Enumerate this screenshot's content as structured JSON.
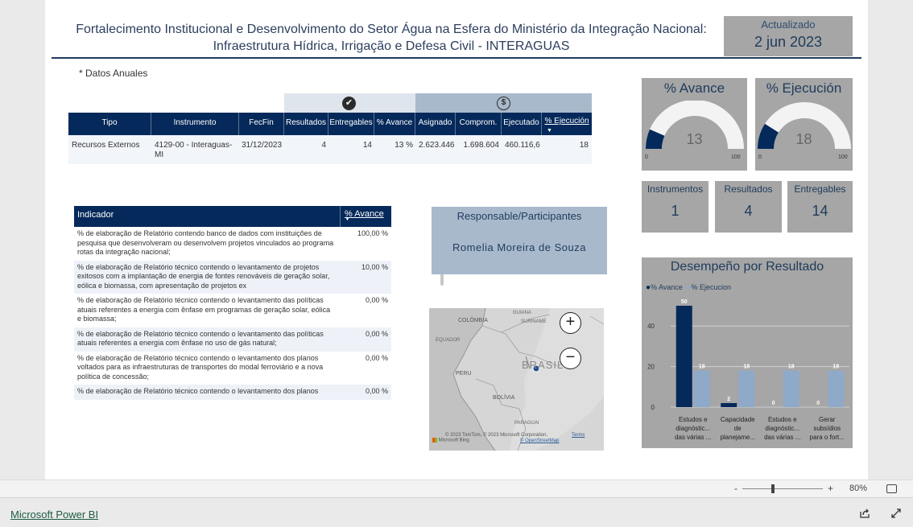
{
  "header": {
    "title_line1": "Fortalecimento Institucional e Desenvolvimento do Setor Água na Esfera do Ministério da Integração Nacional:",
    "title_line2": "Infraestrutura Hídrica, Irrigação e Defesa Civil - INTERAGUAS",
    "updated_label": "Actualizado",
    "updated_value": "2 jun 2023"
  },
  "note": "* Datos Anuales",
  "summary_table": {
    "group_icons": [
      "check-circle-icon",
      "dollar-circle-icon"
    ],
    "columns": [
      "Tipo",
      "Instrumento",
      "FecFin",
      "Resultados",
      "Entregables",
      "% Avance",
      "Asignado",
      "Comprom.",
      "Ejecutado",
      "% Ejecución"
    ],
    "row": [
      "Recursos Externos",
      "4129-00 - Interaguas-MI",
      "31/12/2023",
      "4",
      "14",
      "13 %",
      "2.623.446",
      "1.698.604",
      "460.116,6",
      "18"
    ]
  },
  "indicators": {
    "header_indicador": "Indicador",
    "header_avance": "% Avance",
    "rows": [
      {
        "text": "% de elaboração de Relatório contendo banco de dados com instituições de pesquisa que desenvolveram ou desenvolvem projetos vinculados ao programa rotas da integração nacional;",
        "value": "100,00 %"
      },
      {
        "text": "% de elaboração de Relatório técnico contendo o levantamento de projetos exitosos com a implantação de energia de fontes renováveis de geração solar, eólica e biomassa, com apresentação de projetos ex",
        "value": "10,00 %"
      },
      {
        "text": "% de elaboração de Relatório técnico contendo o levantamento das políticas atuais referentes a energia com ênfase em programas de geração solar, eólica e biomassa;",
        "value": "0,00 %"
      },
      {
        "text": "% de elaboração de Relatório técnico contendo o levantamento das políticas atuais referentes a energia com ênfase no uso de gás natural;",
        "value": "0,00 %"
      },
      {
        "text": "% de elaboração de Relatório técnico contendo o levantamento dos planos voltados para as infraestruturas de transportes do modal ferroviário e a nova política de concessão;",
        "value": "0,00 %"
      },
      {
        "text": "% de elaboração de Relatório técnico contendo o levantamento dos planos",
        "value": "0,00 %"
      }
    ]
  },
  "responsable": {
    "label": "Responsable/Participantes",
    "name": "Romelia Moreira de Souza"
  },
  "map": {
    "labels": [
      "GUIANA",
      "COLÔMBIA",
      "SURINAME",
      "EQUADOR",
      "BRASIL",
      "PERU",
      "BOLÍVIA",
      "PARAGUAI"
    ],
    "copyright": "© 2023 TomTom, © 2023 Microsoft Corporation,",
    "terms": "Terms",
    "osm": "© OpenStreetMap",
    "bing": "Microsoft Bing"
  },
  "gauges": [
    {
      "title": "% Avance",
      "value": "13",
      "fill": 0.13,
      "min": "0",
      "max": "100"
    },
    {
      "title": "% Ejecución",
      "value": "18",
      "fill": 0.18,
      "min": "0",
      "max": "100"
    }
  ],
  "cards": [
    {
      "label": "Instrumentos",
      "value": "1"
    },
    {
      "label": "Resultados",
      "value": "4"
    },
    {
      "label": "Entregables",
      "value": "14"
    }
  ],
  "colors": {
    "navy": "#05295a",
    "light_series": "#8fa9c9",
    "card_bg": "#a6a6a6"
  },
  "chart_data": {
    "type": "bar",
    "title": "Desempeño por Resultado",
    "categories": [
      "Estudos e diagnóstic... das várias ...",
      "Capacidade de planejame...",
      "Estudos e diagnóstic... das várias ...",
      "Gerar subsídios para o fort..."
    ],
    "category_lines": [
      [
        "Estudos e",
        "diagnóstic...",
        "das várias ..."
      ],
      [
        "Capacidade",
        "de",
        "planejame..."
      ],
      [
        "Estudos e",
        "diagnóstic...",
        "das várias ..."
      ],
      [
        "Gerar",
        "subsídios",
        "para o fort..."
      ]
    ],
    "series": [
      {
        "name": "% Avance",
        "values": [
          50,
          2,
          0,
          0
        ],
        "color": "#05295a"
      },
      {
        "name": "% Ejecucion",
        "values": [
          18,
          18,
          18,
          18
        ],
        "color": "#8fa9c9"
      }
    ],
    "ylim": [
      0,
      50
    ],
    "yticks": [
      0,
      20,
      40
    ],
    "legend_position": "top-left",
    "grid": true
  },
  "zoom": {
    "minus": "-",
    "plus": "+",
    "level": "80%"
  },
  "footer": {
    "brand": "Microsoft Power BI"
  }
}
